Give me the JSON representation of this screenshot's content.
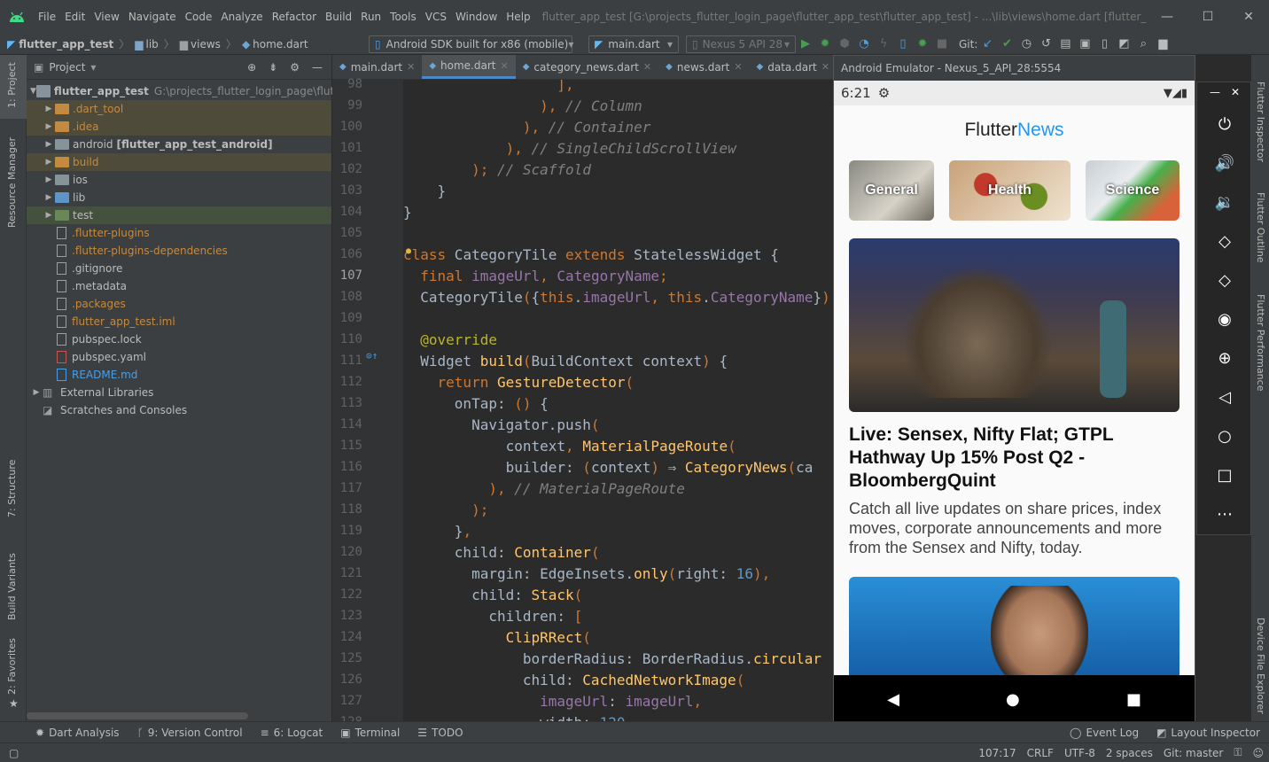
{
  "menubar": {
    "items": [
      "File",
      "Edit",
      "View",
      "Navigate",
      "Code",
      "Analyze",
      "Refactor",
      "Build",
      "Run",
      "Tools",
      "VCS",
      "Window",
      "Help"
    ],
    "title": "flutter_app_test [G:\\projects_flutter_login_page\\flutter_app_test\\flutter_app_test] - ...\\lib\\views\\home.dart [flutter_app_test]"
  },
  "navbar": {
    "crumbs": [
      "flutter_app_test",
      "lib",
      "views",
      "home.dart"
    ],
    "device": "Android SDK built for x86 (mobile)",
    "run_config": "main.dart",
    "avd": "Nexus 5 API 28",
    "git_label": "Git:"
  },
  "left_stripe": [
    "1: Project",
    "Resource Manager",
    "7: Structure",
    "Build Variants",
    "2: Favorites"
  ],
  "project": {
    "header": "Project",
    "root": "flutter_app_test",
    "root_path": "G:\\projects_flutter_login_page\\flutter_ap",
    "items": [
      {
        "label": ".dart_tool",
        "kind": "folder-orange",
        "twisty": true,
        "hl": "hl"
      },
      {
        "label": ".idea",
        "kind": "folder-orange",
        "twisty": true,
        "hl": "hl"
      },
      {
        "label": "android",
        "bold": "[flutter_app_test_android]",
        "kind": "folder",
        "twisty": true,
        "hl": ""
      },
      {
        "label": "build",
        "kind": "folder-orange",
        "twisty": true,
        "hl": "hl"
      },
      {
        "label": "ios",
        "kind": "folder",
        "twisty": true,
        "hl": ""
      },
      {
        "label": "lib",
        "kind": "folder-blue",
        "twisty": true,
        "hl": ""
      },
      {
        "label": "test",
        "kind": "folder-green",
        "twisty": true,
        "hl": "hl2"
      },
      {
        "label": ".flutter-plugins",
        "kind": "file",
        "twisty": false,
        "hl": ""
      },
      {
        "label": ".flutter-plugins-dependencies",
        "kind": "file",
        "twisty": false,
        "hl": ""
      },
      {
        "label": ".gitignore",
        "kind": "file",
        "twisty": false,
        "hl": ""
      },
      {
        "label": ".metadata",
        "kind": "file",
        "twisty": false,
        "hl": ""
      },
      {
        "label": ".packages",
        "kind": "file",
        "twisty": false,
        "hl": ""
      },
      {
        "label": "flutter_app_test.iml",
        "kind": "file",
        "twisty": false,
        "hl": ""
      },
      {
        "label": "pubspec.lock",
        "kind": "file",
        "twisty": false,
        "hl": ""
      },
      {
        "label": "pubspec.yaml",
        "kind": "yaml",
        "twisty": false,
        "hl": ""
      },
      {
        "label": "README.md",
        "kind": "md",
        "twisty": false,
        "hl": ""
      }
    ],
    "external": "External Libraries",
    "scratches": "Scratches and Consoles"
  },
  "editor": {
    "tabs": [
      "main.dart",
      "home.dart",
      "category_news.dart",
      "news.dart",
      "data.dart"
    ],
    "active_tab": 1,
    "current_line": "107",
    "lines": [
      {
        "n": "98",
        "t": "                  ],"
      },
      {
        "n": "99",
        "t": "                ), // Column"
      },
      {
        "n": "100",
        "t": "              ), // Container"
      },
      {
        "n": "101",
        "t": "            ), // SingleChildScrollView"
      },
      {
        "n": "102",
        "t": "        ); // Scaffold"
      },
      {
        "n": "103",
        "t": "    }"
      },
      {
        "n": "104",
        "t": "}"
      },
      {
        "n": "105",
        "t": ""
      },
      {
        "n": "106",
        "t": "class CategoryTile extends StatelessWidget {"
      },
      {
        "n": "107",
        "t": "  final imageUrl, CategoryName;"
      },
      {
        "n": "108",
        "t": "  CategoryTile({this.imageUrl, this.CategoryName});"
      },
      {
        "n": "109",
        "t": ""
      },
      {
        "n": "110",
        "t": "  @override"
      },
      {
        "n": "111",
        "t": "  Widget build(BuildContext context) {"
      },
      {
        "n": "112",
        "t": "    return GestureDetector("
      },
      {
        "n": "113",
        "t": "      onTap: () {"
      },
      {
        "n": "114",
        "t": "        Navigator.push("
      },
      {
        "n": "115",
        "t": "            context, MaterialPageRoute("
      },
      {
        "n": "116",
        "t": "            builder: (context) ⇒ CategoryNews(ca"
      },
      {
        "n": "117",
        "t": "          ), // MaterialPageRoute"
      },
      {
        "n": "118",
        "t": "        );"
      },
      {
        "n": "119",
        "t": "      },"
      },
      {
        "n": "120",
        "t": "      child: Container("
      },
      {
        "n": "121",
        "t": "        margin: EdgeInsets.only(right: 16),"
      },
      {
        "n": "122",
        "t": "        child: Stack("
      },
      {
        "n": "123",
        "t": "          children: ["
      },
      {
        "n": "124",
        "t": "            ClipRRect("
      },
      {
        "n": "125",
        "t": "              borderRadius: BorderRadius.circular"
      },
      {
        "n": "126",
        "t": "              child: CachedNetworkImage("
      },
      {
        "n": "127",
        "t": "                imageUrl: imageUrl,"
      },
      {
        "n": "128",
        "t": "                width: 120,"
      }
    ]
  },
  "emulator": {
    "title": "Android Emulator - Nexus_5_API_28:5554",
    "time": "6:21",
    "app_title_a": "Flutter",
    "app_title_b": "News",
    "categories": [
      "General",
      "Health",
      "Science"
    ],
    "article_title": "Live: Sensex, Nifty Flat; GTPL Hathway Up 15% Post Q2 - BloombergQuint",
    "article_desc": "Catch all live updates on share prices, index moves, corporate announcements and more from the Sensex and Nifty, today."
  },
  "right_stripe": [
    "Flutter Inspector",
    "Flutter Outline",
    "Flutter Performance",
    "Device File Explorer"
  ],
  "toolwindows": [
    "Dart Analysis",
    "9: Version Control",
    "6: Logcat",
    "Terminal",
    "TODO"
  ],
  "toolwindows_right": [
    "Event Log",
    "Layout Inspector"
  ],
  "status": {
    "pos": "107:17",
    "eol": "CRLF",
    "enc": "UTF-8",
    "indent": "2 spaces",
    "git": "Git: master"
  }
}
